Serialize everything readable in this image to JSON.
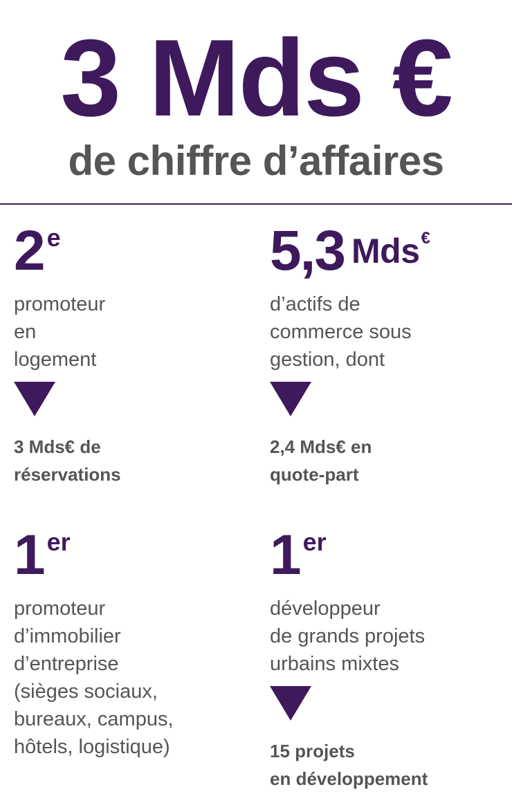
{
  "header": {
    "headline": "3 Mds €",
    "subheadline": "de chiffre d’affaires"
  },
  "colors": {
    "accent": "#3e1a5c",
    "text": "#555555"
  },
  "blocks": [
    {
      "big": "2",
      "sup": "e",
      "desc": [
        "promoteur",
        "en",
        "logement"
      ],
      "note": [
        "3 Mds€ de",
        "réservations"
      ]
    },
    {
      "big": "5,3",
      "unit": "Mds",
      "unit_sup": "€",
      "desc": [
        "d’actifs de",
        "commerce sous",
        "gestion, dont"
      ],
      "note": [
        "2,4 Mds€ en",
        "quote-part"
      ]
    },
    {
      "big": "1",
      "sup": "er",
      "desc": [
        "promoteur",
        "d’immobilier",
        "d’entreprise",
        "(sièges sociaux,",
        "bureaux, campus,",
        "hôtels, logistique)"
      ]
    },
    {
      "big": "1",
      "sup": "er",
      "desc": [
        "développeur",
        "de grands projets",
        "urbains mixtes"
      ],
      "note": [
        "15 projets",
        "en développement"
      ]
    }
  ]
}
